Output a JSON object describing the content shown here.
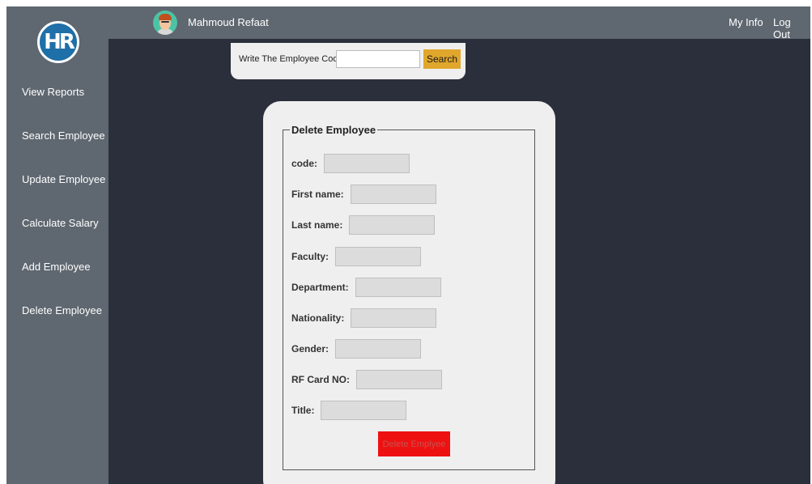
{
  "user": {
    "name": "Mahmoud Refaat"
  },
  "header": {
    "my_info": "My Info",
    "log_out": "Log Out"
  },
  "logo": {
    "text": "HR"
  },
  "sidebar": {
    "items": [
      {
        "label": "View Reports"
      },
      {
        "label": "Search Employee"
      },
      {
        "label": "Update Employee"
      },
      {
        "label": "Calculate Salary"
      },
      {
        "label": "Add Employee"
      },
      {
        "label": "Delete Employee"
      }
    ]
  },
  "search": {
    "label": "Write The Employee Code",
    "value": "",
    "button": "Search"
  },
  "form": {
    "legend": "Delete Employee",
    "fields": [
      {
        "label": "code:",
        "value": ""
      },
      {
        "label": "First name:",
        "value": ""
      },
      {
        "label": "Last name:",
        "value": ""
      },
      {
        "label": "Faculty:",
        "value": ""
      },
      {
        "label": "Department:",
        "value": ""
      },
      {
        "label": "Nationality:",
        "value": ""
      },
      {
        "label": "Gender:",
        "value": ""
      },
      {
        "label": "RF Card NO:",
        "value": ""
      },
      {
        "label": "Title:",
        "value": ""
      }
    ],
    "submit": "Delete Emplyee"
  },
  "colors": {
    "sidebar": "#5f6770",
    "background": "#2b2f3b",
    "search_button": "#e0a72c",
    "delete_button": "#ee1111"
  }
}
